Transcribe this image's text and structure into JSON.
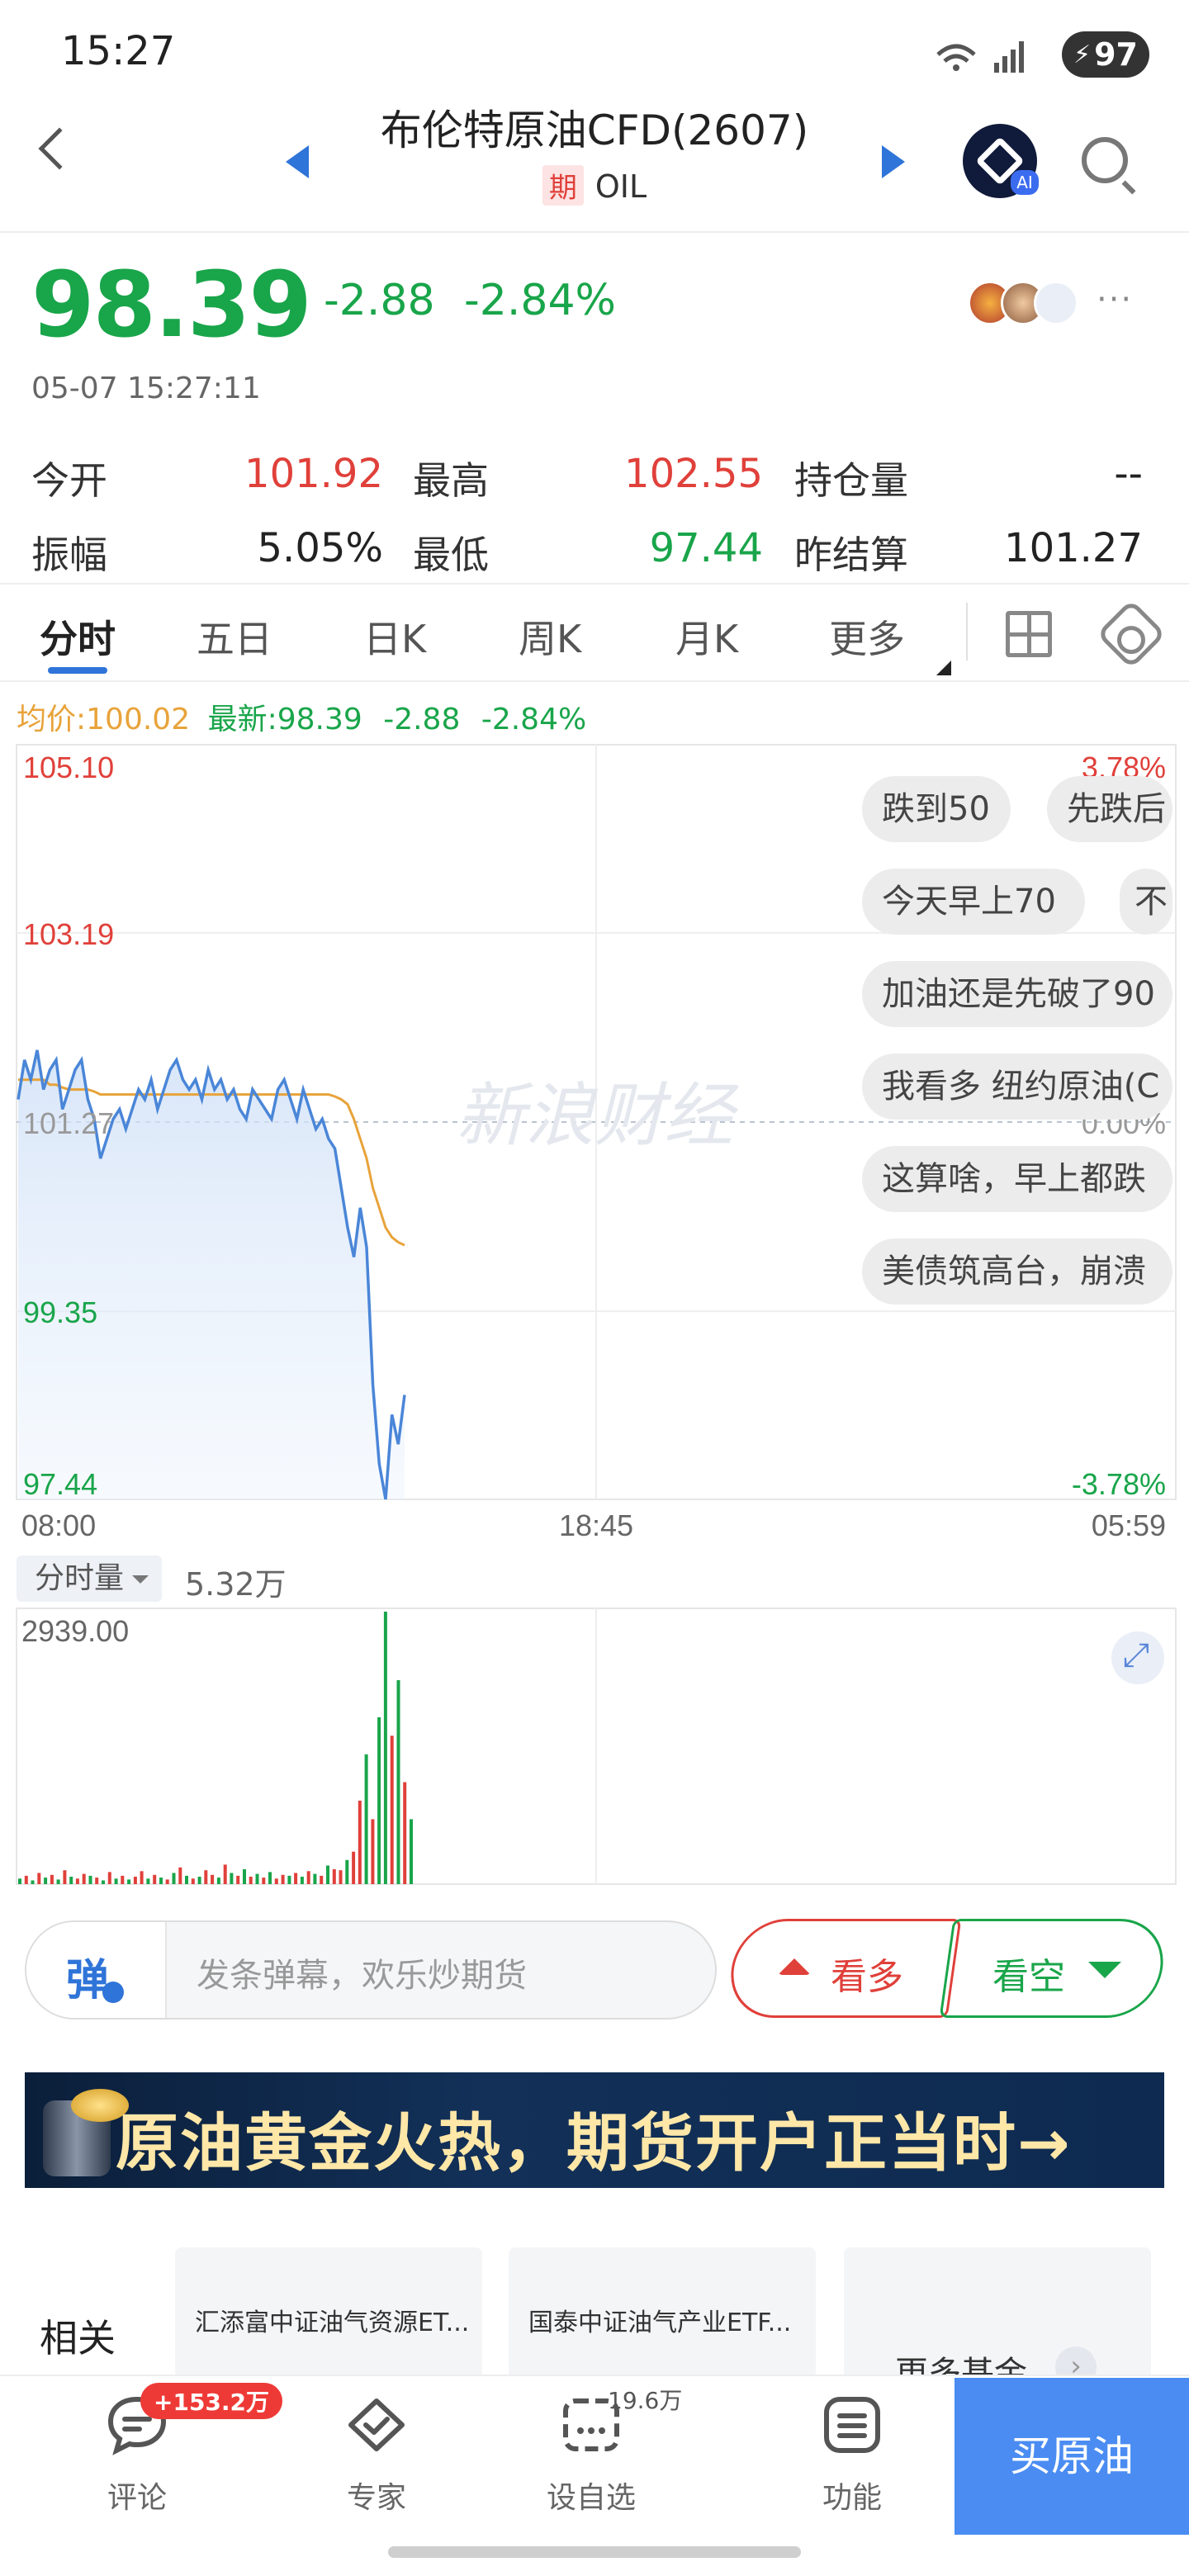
{
  "status": {
    "time": "15:27",
    "battery": "97"
  },
  "header": {
    "title": "布伦特原油CFD(2607)",
    "tag": "期",
    "code": "OIL",
    "ai_label": "AI"
  },
  "quote": {
    "price": "98.39",
    "change": "-2.88",
    "change_pct": "-2.84%",
    "timestamp": "05-07 15:27:11",
    "more": "···",
    "stats": [
      {
        "label": "今开",
        "value": "101.92",
        "color": "#e0403a"
      },
      {
        "label": "最高",
        "value": "102.55",
        "color": "#e0403a"
      },
      {
        "label": "持仓量",
        "value": "--",
        "color": "#222222"
      },
      {
        "label": "振幅",
        "value": "5.05%",
        "color": "#222222"
      },
      {
        "label": "最低",
        "value": "97.44",
        "color": "#19a54a"
      },
      {
        "label": "昨结算",
        "value": "101.27",
        "color": "#222222"
      }
    ]
  },
  "tabs": [
    "分时",
    "五日",
    "日K",
    "周K",
    "月K",
    "更多"
  ],
  "legend": {
    "avg": "均价:100.02",
    "latest": "最新:98.39",
    "chg": "-2.88",
    "pct": "-2.84%"
  },
  "watermark": "新浪财经",
  "comments": [
    "跌到50",
    "先跌后",
    "今天早上70",
    "不",
    "加油还是先破了90",
    "我看多 纽约原油(C",
    "这算啥，早上都跌",
    "美债筑高台，崩溃"
  ],
  "volume": {
    "selector": "分时量",
    "total": "5.32万"
  },
  "input": {
    "icon": "弹",
    "placeholder": "发条弹幕，欢乐炒期货"
  },
  "actions": {
    "bull": "看多",
    "bear": "看空"
  },
  "banner": {
    "text": "原油黄金火热，期货开户正当时→"
  },
  "related": {
    "label": "相关",
    "cards": [
      "汇添富中证油气资源ET...",
      "国泰中证油气产业ETF..."
    ],
    "more": "更多基金",
    "more_arrow": "›"
  },
  "nav": {
    "badge": "+153.2万",
    "sub_count": "19.6万",
    "items": [
      "评论",
      "专家",
      "设自选",
      "功能"
    ],
    "buy": "买原油"
  },
  "colors": {
    "up": "#e0403a",
    "down": "#19a54a",
    "accent": "#2f74d8",
    "avg_line": "#e8a33a",
    "price_line": "#4a86d8"
  },
  "chart_data": [
    {
      "type": "line",
      "title": "",
      "x_ticks": [
        "08:00",
        "18:45",
        "05:59"
      ],
      "y_ticks": [
        105.1,
        103.19,
        101.27,
        99.35,
        97.44
      ],
      "pct_ticks": [
        "3.78%",
        "0.00%",
        "-3.78%"
      ],
      "ylim": [
        97.44,
        105.1
      ],
      "reference": 101.27,
      "series": [
        {
          "name": "最新",
          "values": [
            101.5,
            101.9,
            101.7,
            102.0,
            101.6,
            101.8,
            101.9,
            101.4,
            101.6,
            101.8,
            101.9,
            101.5,
            101.3,
            100.9,
            101.1,
            101.3,
            101.4,
            101.2,
            101.4,
            101.6,
            101.5,
            101.7,
            101.4,
            101.6,
            101.8,
            101.9,
            101.7,
            101.6,
            101.7,
            101.5,
            101.8,
            101.6,
            101.7,
            101.5,
            101.6,
            101.4,
            101.3,
            101.6,
            101.5,
            101.4,
            101.3,
            101.6,
            101.7,
            101.5,
            101.3,
            101.6,
            101.4,
            101.2,
            101.3,
            101.1,
            101.0,
            100.6,
            100.2,
            99.9,
            100.4,
            100.0,
            98.6,
            97.8,
            97.44,
            98.3,
            98.0,
            98.5
          ]
        },
        {
          "name": "均价",
          "values": [
            101.7,
            101.7,
            101.7,
            101.7,
            101.7,
            101.65,
            101.65,
            101.62,
            101.6,
            101.6,
            101.6,
            101.6,
            101.58,
            101.55,
            101.55,
            101.55,
            101.55,
            101.55,
            101.55,
            101.55,
            101.55,
            101.55,
            101.55,
            101.55,
            101.55,
            101.55,
            101.55,
            101.55,
            101.55,
            101.55,
            101.55,
            101.55,
            101.55,
            101.55,
            101.55,
            101.55,
            101.55,
            101.55,
            101.55,
            101.55,
            101.55,
            101.55,
            101.55,
            101.55,
            101.55,
            101.55,
            101.55,
            101.55,
            101.55,
            101.55,
            101.53,
            101.5,
            101.45,
            101.3,
            101.1,
            100.9,
            100.6,
            100.4,
            100.2,
            100.1,
            100.05,
            100.02
          ]
        }
      ]
    },
    {
      "type": "bar",
      "title": "",
      "y_max_label": "2939.00",
      "ylim": [
        0,
        2939
      ],
      "values": [
        60,
        90,
        40,
        120,
        70,
        100,
        50,
        150,
        80,
        60,
        110,
        90,
        70,
        40,
        130,
        60,
        90,
        50,
        80,
        140,
        60,
        100,
        70,
        50,
        120,
        180,
        90,
        60,
        80,
        150,
        100,
        70,
        210,
        120,
        90,
        160,
        80,
        110,
        70,
        130,
        60,
        100,
        90,
        120,
        80,
        140,
        110,
        90,
        200,
        160,
        150,
        260,
        350,
        900,
        1400,
        700,
        1800,
        2939,
        1600,
        2200,
        1100,
        700
      ],
      "colors": [
        "g",
        "r",
        "g",
        "r",
        "g",
        "r",
        "g",
        "r",
        "g",
        "r",
        "r",
        "g",
        "r",
        "g",
        "r",
        "g",
        "r",
        "g",
        "r",
        "r",
        "g",
        "r",
        "g",
        "r",
        "g",
        "r",
        "g",
        "r",
        "g",
        "r",
        "r",
        "g",
        "r",
        "g",
        "r",
        "g",
        "r",
        "g",
        "r",
        "g",
        "r",
        "r",
        "g",
        "r",
        "g",
        "r",
        "g",
        "r",
        "g",
        "r",
        "r",
        "g",
        "r",
        "r",
        "g",
        "r",
        "g",
        "g",
        "r",
        "g",
        "r",
        "g"
      ]
    }
  ]
}
